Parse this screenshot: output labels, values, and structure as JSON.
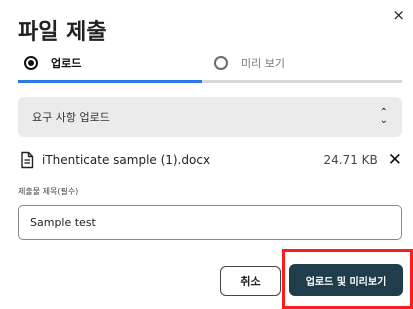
{
  "dialog": {
    "title": "파일 제출",
    "close_label": "×"
  },
  "steps": {
    "items": [
      {
        "label": "업로드",
        "active": true
      },
      {
        "label": "미리 보기",
        "active": false
      }
    ],
    "progress": 0.48
  },
  "requirements": {
    "label": "요구 사항 업로드"
  },
  "file": {
    "name": "iThenticate sample (1).docx",
    "size": "24.71 KB",
    "remove_label": "✕"
  },
  "title_field": {
    "label": "제출물 제목(필수)",
    "value": "Sample test"
  },
  "actions": {
    "cancel_label": "취소",
    "submit_label": "업로드 및 미리보기"
  },
  "colors": {
    "primary_button": "#1f3d4a",
    "progress": "#2b78ea",
    "highlight": "#ff1b1b"
  }
}
